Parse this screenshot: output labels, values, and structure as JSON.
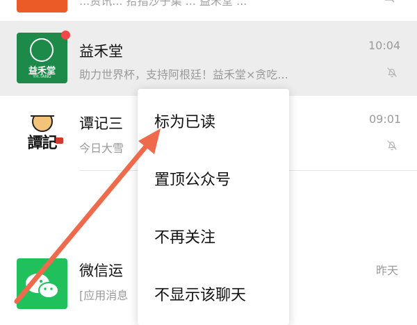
{
  "top_row": {
    "preview": "...资讯... 拾指沙子集 ... 益禾堂 ..."
  },
  "chats": [
    {
      "id": "yihetang",
      "title": "益禾堂",
      "preview": "助力世界杯，支持阿根廷！益禾堂×贪吃...",
      "time": "10:04",
      "avatar_text": "益禾堂",
      "avatar_sub": "YH.TANG",
      "muted": true,
      "unread_dot": true
    },
    {
      "id": "tanji",
      "title": "谭记三",
      "preview": "今日大雪",
      "time": "09:01",
      "avatar_text": "譚記",
      "muted": true
    },
    {
      "id": "wechat-sport",
      "title": "微信运",
      "preview": "[应用消息",
      "time": "昨天",
      "muted": false
    }
  ],
  "context_menu": {
    "items": [
      {
        "label": "标为已读"
      },
      {
        "label": "置顶公众号"
      },
      {
        "label": "不再关注"
      },
      {
        "label": "不显示该聊天"
      }
    ]
  },
  "colors": {
    "highlight_row": "#ededed",
    "arrow": "#ee6a4c",
    "unread_dot": "#f04848",
    "yihetang_green": "#1e8a4a",
    "wechat_sport_green": "#20c05c",
    "top_avatar_orange": "#ea5b28"
  },
  "icons": {
    "mute": "bell-slash-icon",
    "wechat_sport": "wechat-chat-bubbles-icon",
    "annotation": "arrow-pointer-icon"
  }
}
